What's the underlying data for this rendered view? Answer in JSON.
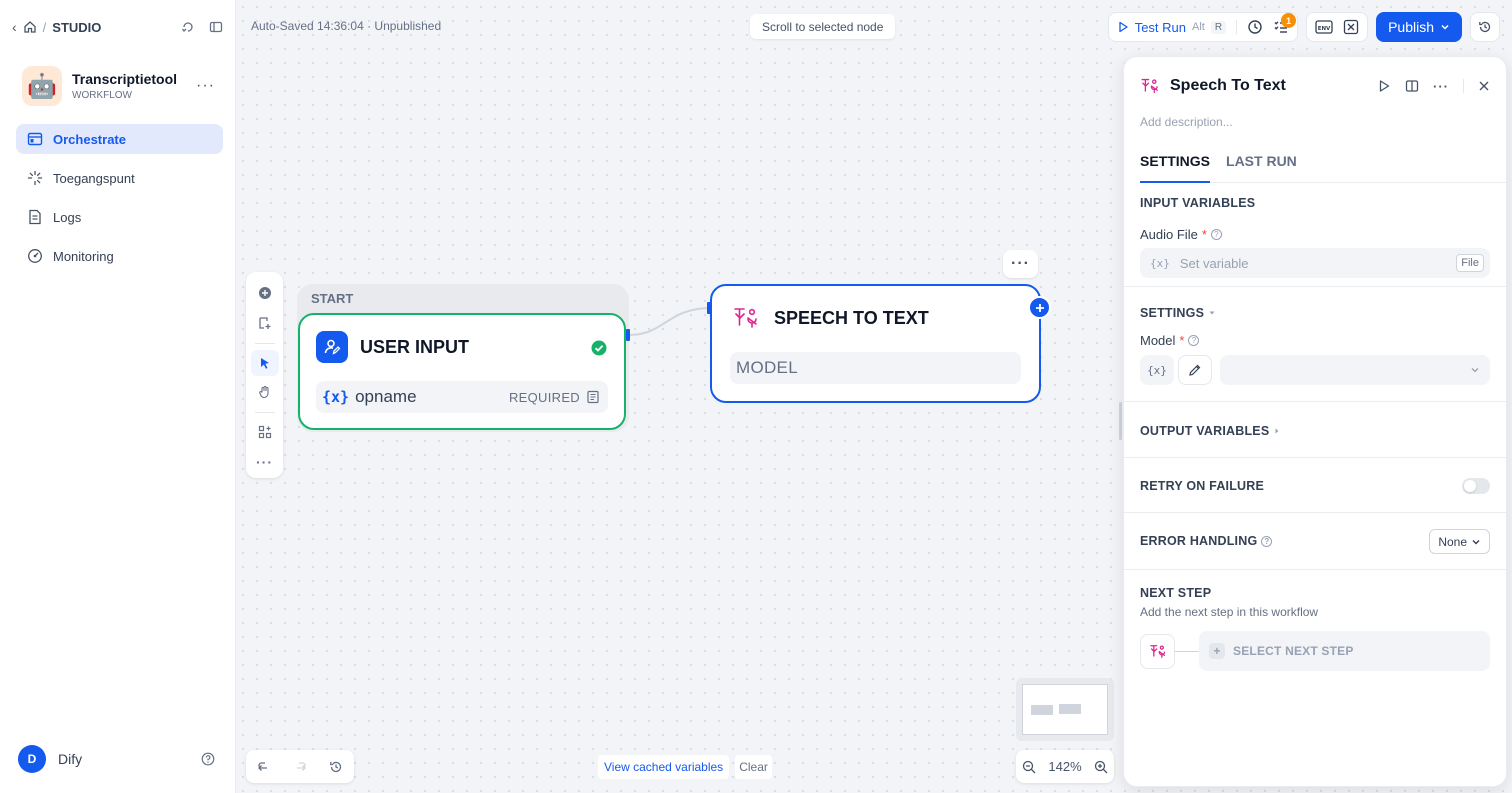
{
  "sidebar": {
    "studio_label": "STUDIO",
    "app": {
      "name": "Transcriptietool",
      "type": "WORKFLOW",
      "avatar_emoji": "🤖"
    },
    "nav": [
      {
        "label": "Orchestrate",
        "icon": "layout-icon",
        "active": true
      },
      {
        "label": "Toegangspunt",
        "icon": "access-point-icon",
        "active": false
      },
      {
        "label": "Logs",
        "icon": "logs-icon",
        "active": false
      },
      {
        "label": "Monitoring",
        "icon": "monitoring-icon",
        "active": false
      }
    ],
    "user": {
      "initial": "D",
      "name": "Dify"
    }
  },
  "topbar": {
    "autosave": "Auto-Saved 14:36:04 · Unpublished",
    "scroll_button": "Scroll to selected node",
    "test_run": {
      "label": "Test Run",
      "shortcut_mod": "Alt",
      "shortcut_key": "R"
    },
    "checklist_badge": "1",
    "env_label": "ENV",
    "publish_label": "Publish"
  },
  "canvas": {
    "start_label": "START",
    "user_input_node": {
      "title": "USER INPUT",
      "variable": "opname",
      "required_label": "REQUIRED"
    },
    "stt_node": {
      "title": "SPEECH TO TEXT",
      "model_label": "MODEL"
    },
    "cached_vars_label": "View cached variables",
    "clear_label": "Clear",
    "zoom_level": "142%"
  },
  "panel": {
    "title": "Speech To Text",
    "description_placeholder": "Add description...",
    "tabs": [
      "SETTINGS",
      "LAST RUN"
    ],
    "input_variables_title": "INPUT VARIABLES",
    "audio_file_label": "Audio File",
    "audio_file_placeholder": "Set variable",
    "audio_file_tag": "File",
    "settings_title": "SETTINGS",
    "model_label": "Model",
    "var_symbol": "{x}",
    "output_variables_title": "OUTPUT VARIABLES",
    "retry_title": "RETRY ON FAILURE",
    "retry_enabled": false,
    "error_handling_title": "ERROR HANDLING",
    "error_handling_value": "None",
    "next_step_title": "NEXT STEP",
    "next_step_desc": "Add the next step in this workflow",
    "select_next_step": "SELECT NEXT STEP"
  },
  "colors": {
    "accent": "#155aef",
    "success": "#17b26a",
    "stt_pink": "#dd2590",
    "badge_orange": "#f79009"
  }
}
